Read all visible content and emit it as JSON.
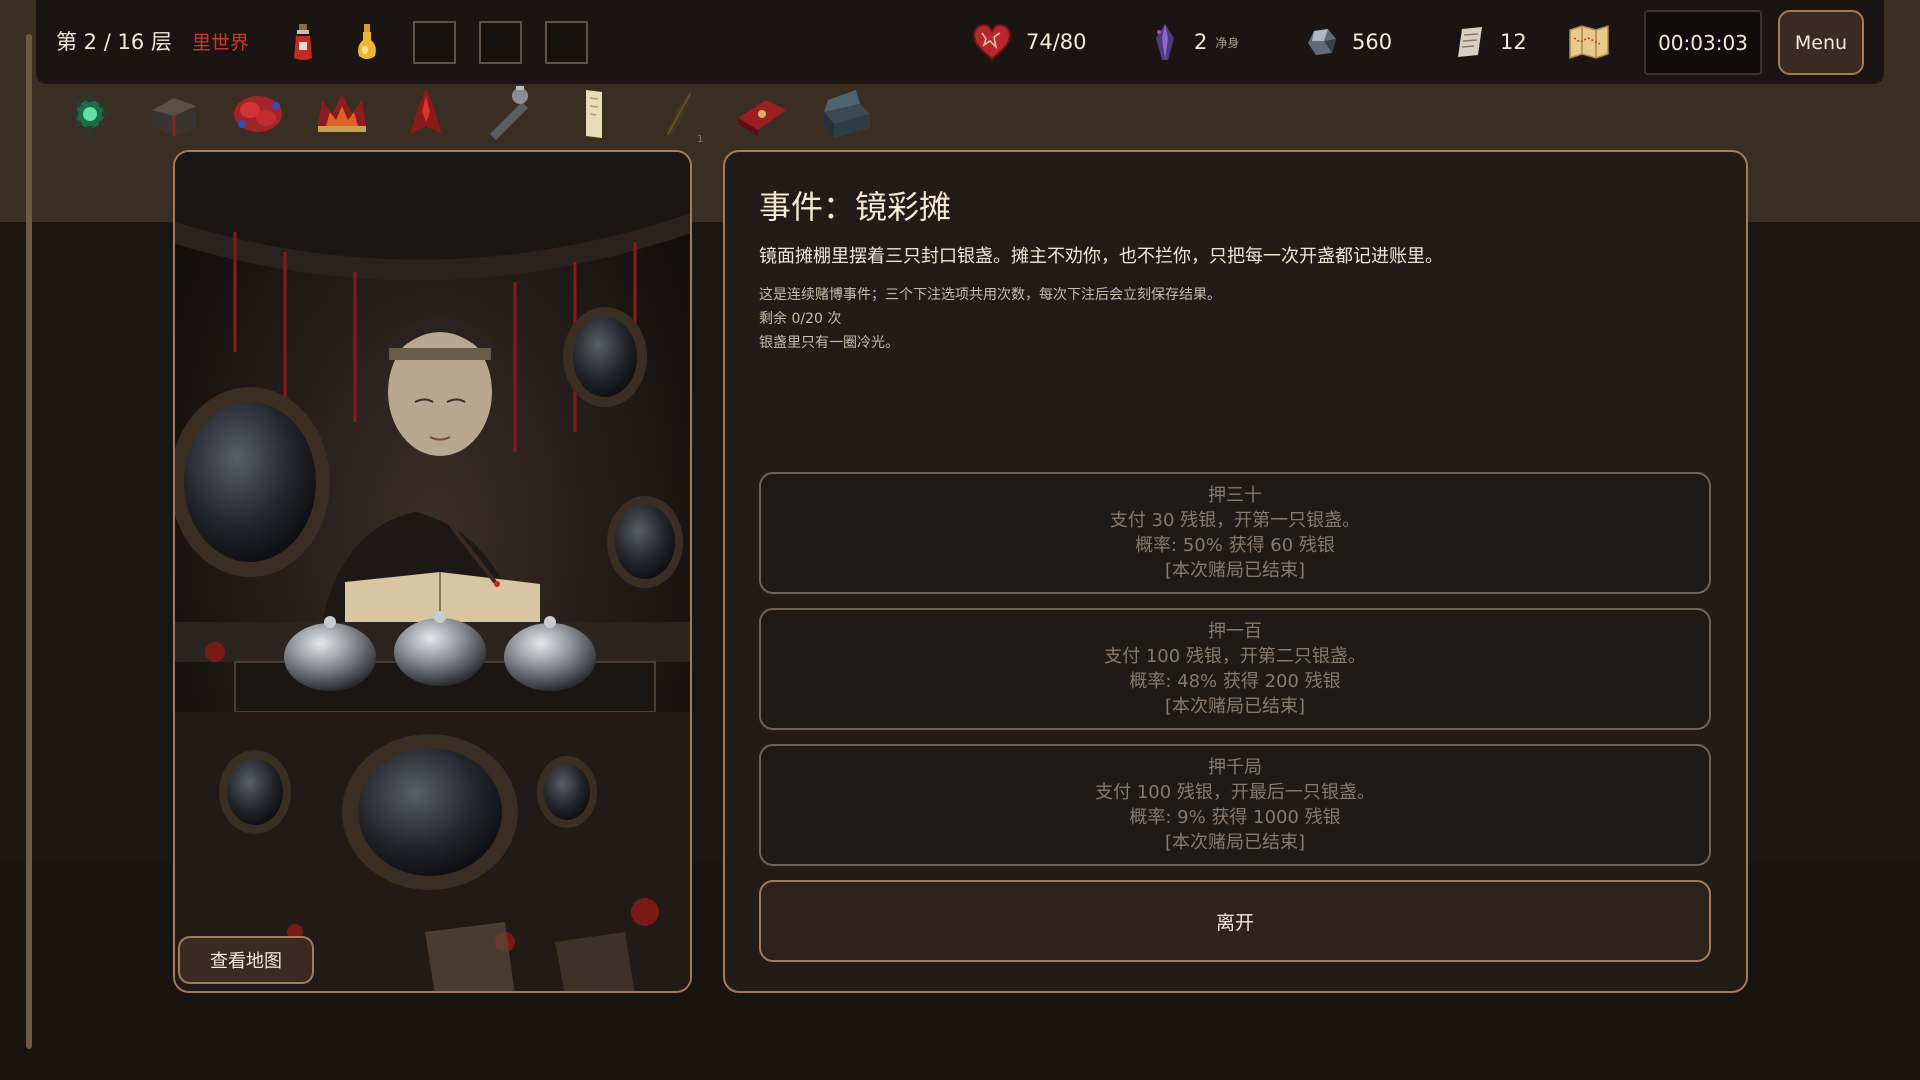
{
  "topbar": {
    "floor": "第 2 / 16 层",
    "world": "里世界",
    "hp": "74/80",
    "purify_value": "2",
    "purify_label": "净身",
    "silver": "560",
    "scrolls": "12",
    "timer": "00:03:03",
    "menu_label": "Menu"
  },
  "relics": {
    "count_badge": "1",
    "items": [
      "green-spiked-orb",
      "dark-chest",
      "red-flower",
      "flaming-crown",
      "red-claw",
      "iron-lantern",
      "candle-scroll",
      "faded-feather",
      "red-tome",
      "open-casket"
    ]
  },
  "map_button": "查看地图",
  "event": {
    "title": "事件：镜彩摊",
    "description": "镜面摊棚里摆着三只封口银盏。摊主不劝你，也不拦你，只把每一次开盏都记进账里。",
    "note_rules": "这是连续赌博事件；三个下注选项共用次数，每次下注后会立刻保存结果。",
    "note_remaining": "剩余 0/20 次",
    "note_flavor": "银盏里只有一圈冷光。",
    "choices": [
      {
        "title": "押三十",
        "cost": "支付 30 残银，开第一只银盏。",
        "odds": "概率: 50% 获得 60 残银",
        "status": "[本次赌局已结束]"
      },
      {
        "title": "押一百",
        "cost": "支付 100 残银，开第二只银盏。",
        "odds": "概率: 48% 获得 200 残银",
        "status": "[本次赌局已结束]"
      },
      {
        "title": "押千局",
        "cost": "支付 100 残银，开最后一只银盏。",
        "odds": "概率: 9% 获得 1000 残银",
        "status": "[本次赌局已结束]"
      }
    ],
    "leave_label": "离开"
  },
  "colors": {
    "accent_border": "#a47b59",
    "world_red": "#d0352d",
    "disabled_text": "#857a70"
  }
}
